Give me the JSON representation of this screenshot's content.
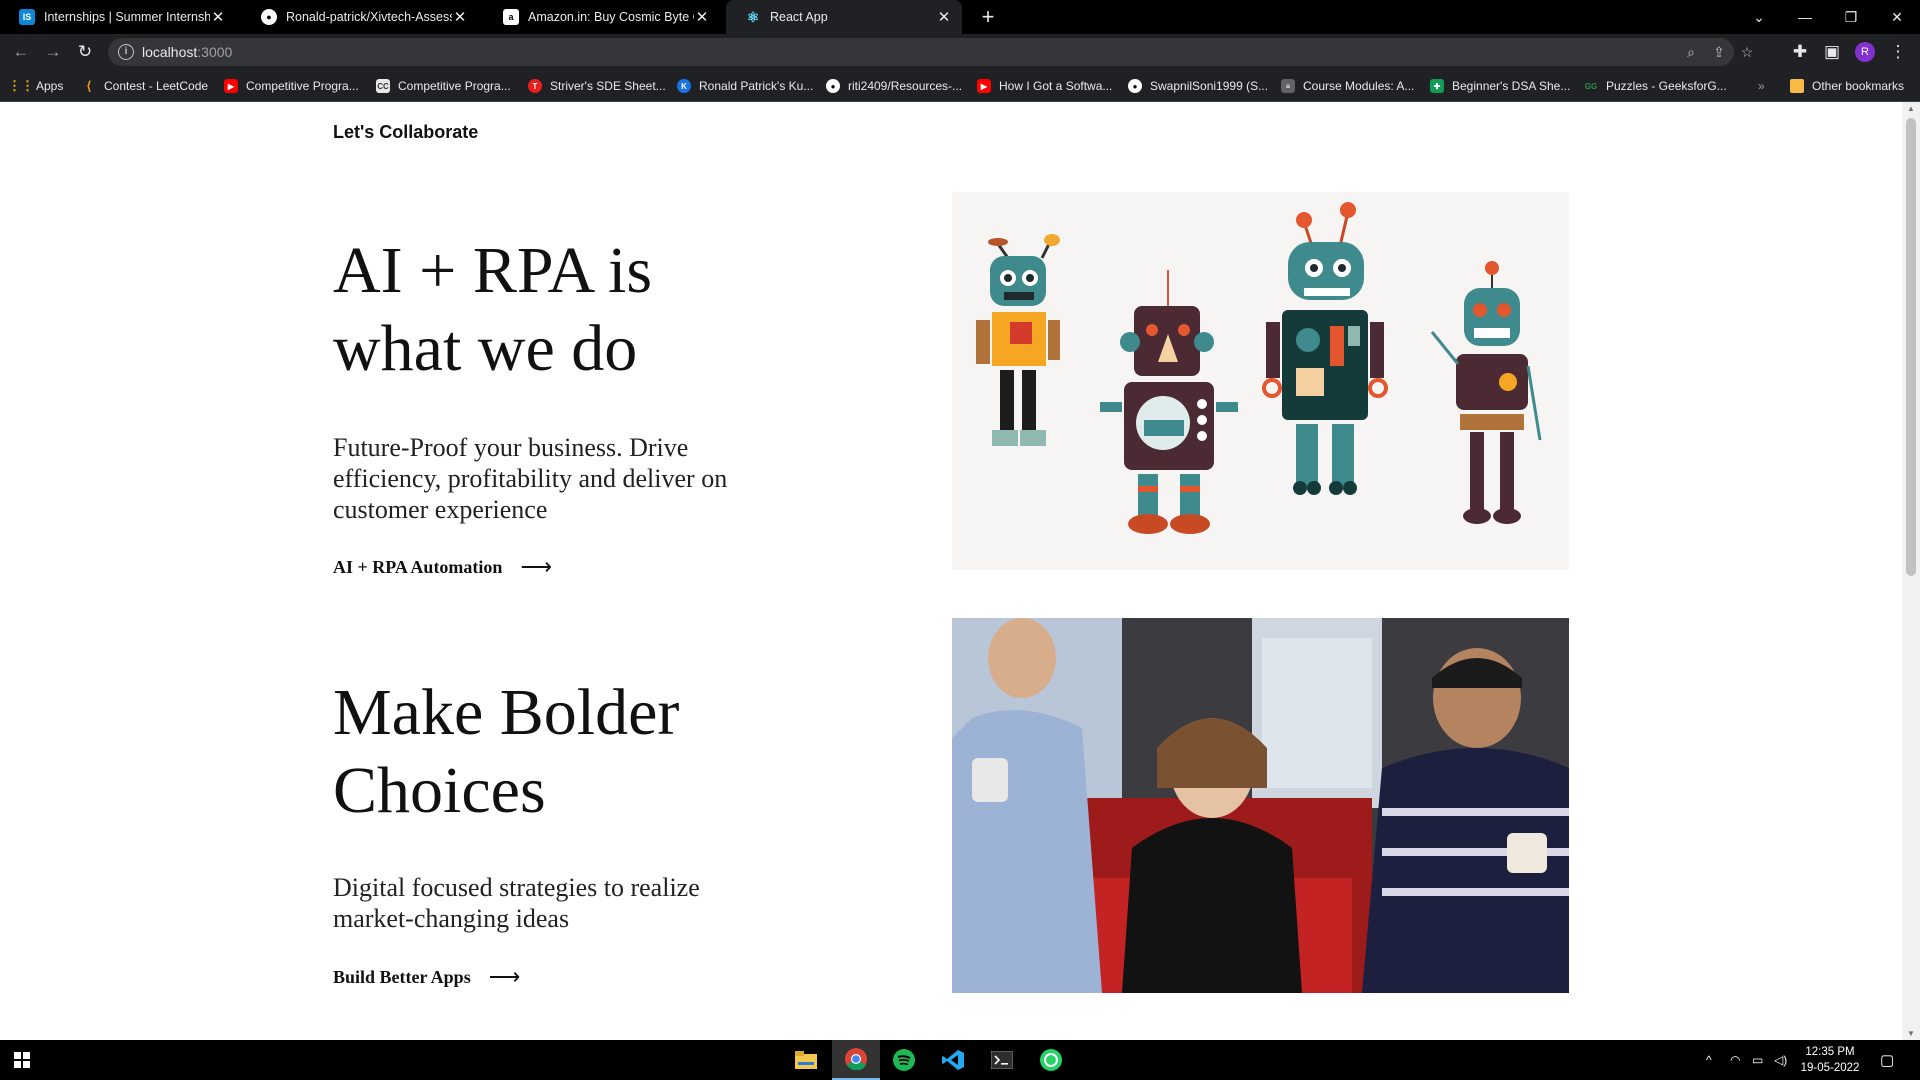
{
  "browser": {
    "tabs": [
      {
        "title": "Internships | Summer Internship",
        "icon": "internshala-icon",
        "active": false
      },
      {
        "title": "Ronald-patrick/Xivtech-Assessme",
        "icon": "github-icon",
        "active": false
      },
      {
        "title": "Amazon.in: Buy Cosmic Byte CB-",
        "icon": "amazon-icon",
        "active": false
      },
      {
        "title": "React App",
        "icon": "react-icon",
        "active": true
      }
    ],
    "url": "localhost",
    "url_port": ":3000",
    "bookmarks": [
      {
        "label": "Apps",
        "icon": "apps-grid-icon",
        "color": "#f4b400"
      },
      {
        "label": "Contest - LeetCode",
        "icon": "leetcode-icon",
        "color": "#ffa116"
      },
      {
        "label": "Competitive Progra...",
        "icon": "youtube-icon",
        "color": "#ff0000"
      },
      {
        "label": "Competitive Progra...",
        "icon": "codechef-icon",
        "color": "#5b4638"
      },
      {
        "label": "Striver's SDE Sheet...",
        "icon": "takeuforward-icon",
        "color": "#e91e1e"
      },
      {
        "label": "Ronald Patrick's Ku...",
        "icon": "kunal-icon",
        "color": "#1a73e8"
      },
      {
        "label": "riti2409/Resources-...",
        "icon": "github-icon",
        "color": "#ffffff"
      },
      {
        "label": "How I Got a Softwa...",
        "icon": "youtube-icon",
        "color": "#ff0000"
      },
      {
        "label": "SwapnilSoni1999 (S...",
        "icon": "github-icon",
        "color": "#ffffff"
      },
      {
        "label": "Course Modules: A...",
        "icon": "course-icon",
        "color": "#5f6368"
      },
      {
        "label": "Beginner's DSA She...",
        "icon": "sheets-icon",
        "color": "#0f9d58"
      },
      {
        "label": "Puzzles - GeeksforG...",
        "icon": "gfg-icon",
        "color": "#2f8d46"
      }
    ],
    "more_bookmarks": "»",
    "other_bookmarks": "Other bookmarks",
    "profile_initial": "R"
  },
  "page": {
    "brand": "Let's Collaborate",
    "sections": [
      {
        "heading_line1": "AI + RPA is",
        "heading_line2": "what we do",
        "lead": "Future-Proof your business. Drive efficiency, profitability and deliver on customer experience",
        "cta": "AI + RPA Automation",
        "image": "robots-illustration"
      },
      {
        "heading_line1": "Make Bolder",
        "heading_line2": "Choices",
        "lead": "Digital focused strategies to realize market-changing ideas",
        "cta": "Build Better Apps",
        "image": "team-collaboration-photo"
      }
    ],
    "cta_arrow": "⟶"
  },
  "taskbar": {
    "apps": [
      "file-explorer-icon",
      "chrome-icon",
      "spotify-icon",
      "vscode-icon",
      "terminal-icon",
      "whatsapp-icon"
    ],
    "time": "12:35 PM",
    "date": "19-05-2022"
  },
  "colors": {
    "chrome_dark": "#202124",
    "taskbar": "#000000",
    "robot_teal": "#3f8a8c",
    "robot_orange": "#f5a623",
    "robot_red": "#e4572e"
  }
}
